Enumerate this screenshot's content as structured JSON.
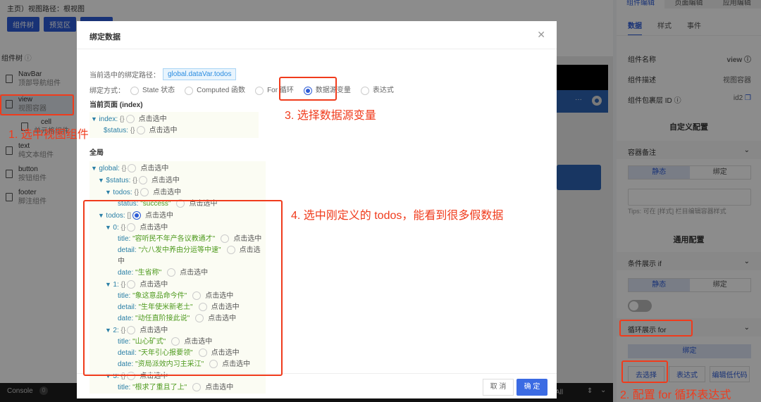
{
  "header": {
    "breadcrumb": "主页）视图路径：根视图",
    "buttons": [
      "组件树",
      "预览区",
      "编辑器"
    ]
  },
  "component_tree": {
    "title": "组件树",
    "items": [
      {
        "name": "NavBar",
        "desc": "顶部导航组件"
      },
      {
        "name": "view",
        "desc": "视图容器"
      },
      {
        "name": "cell",
        "desc": "单元格组件"
      },
      {
        "name": "text",
        "desc": "纯文本组件"
      },
      {
        "name": "button",
        "desc": "按钮组件"
      },
      {
        "name": "footer",
        "desc": "脚注组件"
      }
    ]
  },
  "console": {
    "label": "Console",
    "count": "0",
    "filter": "All"
  },
  "right_panel": {
    "tabs": [
      "组件编辑",
      "页面编辑",
      "应用编辑"
    ],
    "subtabs": [
      "数据",
      "样式",
      "事件"
    ],
    "props": [
      {
        "label": "组件名称",
        "value": "view"
      },
      {
        "label": "组件描述",
        "value": "视图容器"
      },
      {
        "label": "组件包裹层 ID",
        "value": "id2"
      }
    ],
    "custom_section": "自定义配置",
    "container_note": {
      "label": "容器备注",
      "seg": [
        "静态",
        "绑定"
      ],
      "tips": "Tips: 可在 [样式] 栏目编辑容器样式"
    },
    "general_section": "通用配置",
    "if_show": {
      "label": "条件展示 if",
      "seg": [
        "静态",
        "绑定"
      ],
      "toggle_on": false
    },
    "for_show": {
      "label": "循环展示 for",
      "bind": "绑定",
      "buttons": [
        "去选择",
        "表达式",
        "编辑低代码"
      ]
    }
  },
  "modal": {
    "title": "绑定数据",
    "path_label": "当前选中的绑定路径：",
    "path_value": "global.dataVar.todos",
    "mode_label": "绑定方式：",
    "modes": [
      {
        "label": "State 状态",
        "selected": false
      },
      {
        "label": "Computed 函数",
        "selected": false
      },
      {
        "label": "For 循环",
        "selected": false
      },
      {
        "label": "数据源变量",
        "selected": true
      },
      {
        "label": "表达式",
        "selected": false
      }
    ],
    "page_section": "当前页面 (index)",
    "global_section": "全局",
    "select_text": "点击选中",
    "page_tree": [
      {
        "indent": 0,
        "arrow": true,
        "key": "index:",
        "val": "{}"
      },
      {
        "indent": 1,
        "arrow": false,
        "key": "$status:",
        "val": "{}"
      }
    ],
    "global_tree": [
      {
        "indent": 0,
        "arrow": true,
        "key": "global:",
        "val": "{}"
      },
      {
        "indent": 1,
        "arrow": true,
        "key": "$status:",
        "val": "{}"
      },
      {
        "indent": 2,
        "arrow": true,
        "key": "todos:",
        "val": "{}"
      },
      {
        "indent": 3,
        "arrow": false,
        "key": "status:",
        "val": "\"success\"",
        "str": true
      }
    ],
    "todos_tree": [
      {
        "indent": 0,
        "arrow": true,
        "key": "todos:",
        "val": "[]",
        "selected": true
      },
      {
        "indent": 1,
        "arrow": true,
        "key": "0:",
        "val": "{}"
      },
      {
        "indent": 2,
        "key": "title:",
        "val": "\"容听民不年产各议教通才\"",
        "str": true
      },
      {
        "indent": 2,
        "key": "detail:",
        "val": "\"六八发中养由分运等中速\"",
        "str": true
      },
      {
        "indent": 2,
        "key": "date:",
        "val": "\"生省称\"",
        "str": true
      },
      {
        "indent": 1,
        "arrow": true,
        "key": "1:",
        "val": "{}"
      },
      {
        "indent": 2,
        "key": "title:",
        "val": "\"象这意品命今件\"",
        "str": true
      },
      {
        "indent": 2,
        "key": "detail:",
        "val": "\"生年使米新老土\"",
        "str": true
      },
      {
        "indent": 2,
        "key": "date:",
        "val": "\"动任直阶接此说\"",
        "str": true
      },
      {
        "indent": 1,
        "arrow": true,
        "key": "2:",
        "val": "{}"
      },
      {
        "indent": 2,
        "key": "title:",
        "val": "\"山心矿式\"",
        "str": true
      },
      {
        "indent": 2,
        "key": "detail:",
        "val": "\"天年引心报要领\"",
        "str": true
      },
      {
        "indent": 2,
        "key": "date:",
        "val": "\"资局派效内习主采江\"",
        "str": true
      },
      {
        "indent": 1,
        "arrow": true,
        "key": "3:",
        "val": "{}"
      },
      {
        "indent": 2,
        "key": "title:",
        "val": "\"根求了重且了上\"",
        "str": true
      }
    ],
    "cancel": "取 消",
    "ok": "确 定"
  },
  "annotations": {
    "step1": "1. 选中视图组件",
    "step2": "2. 配置 for 循环表达式",
    "step3": "3. 选择数据源变量",
    "step4": "4. 选中刚定义的 todos，能看到很多假数据"
  },
  "colors": {
    "accent": "#2d5bd7",
    "annotation": "#f03b1c",
    "string": "#4e9a1e",
    "key": "#2a7fa6"
  }
}
